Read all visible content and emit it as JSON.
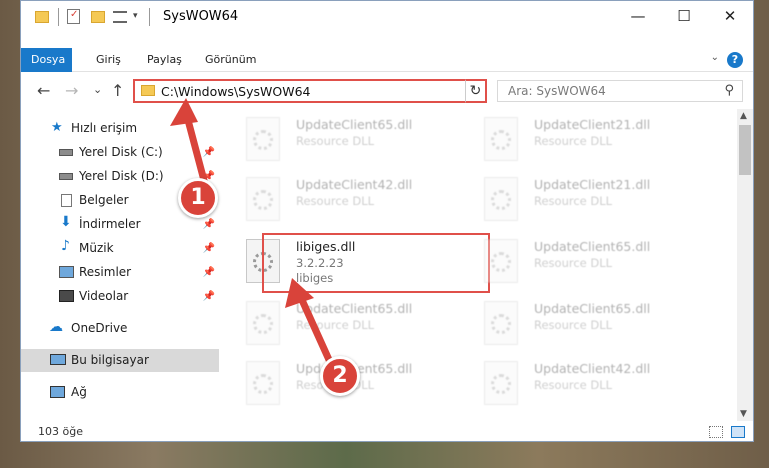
{
  "window": {
    "title": "SysWOW64",
    "minimize": "—",
    "maximize": "☐",
    "close": "✕"
  },
  "ribbon": {
    "tabs": [
      "Dosya",
      "Giriş",
      "Paylaş",
      "Görünüm"
    ],
    "help": "?"
  },
  "nav": {
    "back": "←",
    "forward": "→",
    "recent": "⌄",
    "up": "↑",
    "address": "C:\\Windows\\SysWOW64",
    "refresh": "↻",
    "search_placeholder": "Ara: SysWOW64"
  },
  "sidebar": {
    "items": [
      {
        "label": "Hızlı erişim",
        "icon": "star-icon",
        "pinned": false
      },
      {
        "label": "Yerel Disk (C:)",
        "icon": "drive-icon",
        "pinned": true
      },
      {
        "label": "Yerel Disk (D:)",
        "icon": "drive-icon",
        "pinned": true
      },
      {
        "label": "Belgeler",
        "icon": "documents-icon",
        "pinned": true
      },
      {
        "label": "İndirmeler",
        "icon": "download-icon",
        "pinned": true
      },
      {
        "label": "Müzik",
        "icon": "music-icon",
        "pinned": true
      },
      {
        "label": "Resimler",
        "icon": "pictures-icon",
        "pinned": true
      },
      {
        "label": "Videolar",
        "icon": "videos-icon",
        "pinned": true
      },
      {
        "label": "OneDrive",
        "icon": "cloud-icon",
        "pinned": false
      },
      {
        "label": "Bu bilgisayar",
        "icon": "computer-icon",
        "pinned": false
      },
      {
        "label": "Ağ",
        "icon": "network-icon",
        "pinned": false
      }
    ]
  },
  "files": [
    {
      "name": "UpdateClient65.dll",
      "desc": "Resource DLL",
      "extra": ""
    },
    {
      "name": "UpdateClient21.dll",
      "desc": "Resource DLL",
      "extra": ""
    },
    {
      "name": "UpdateClient42.dll",
      "desc": "Resource DLL",
      "extra": ""
    },
    {
      "name": "UpdateClient21.dll",
      "desc": "Resource DLL",
      "extra": ""
    },
    {
      "name": "libiges.dll",
      "desc": "3.2.2.23",
      "extra": "libiges"
    },
    {
      "name": "UpdateClient65.dll",
      "desc": "Resource DLL",
      "extra": ""
    },
    {
      "name": "UpdateClient65.dll",
      "desc": "Resource DLL",
      "extra": ""
    },
    {
      "name": "UpdateClient65.dll",
      "desc": "Resource DLL",
      "extra": ""
    },
    {
      "name": "UpdateClient65.dll",
      "desc": "Resource DLL",
      "extra": ""
    },
    {
      "name": "UpdateClient42.dll",
      "desc": "Resource DLL",
      "extra": ""
    }
  ],
  "status": {
    "count": "103 öğe"
  },
  "annotations": [
    "1",
    "2"
  ]
}
